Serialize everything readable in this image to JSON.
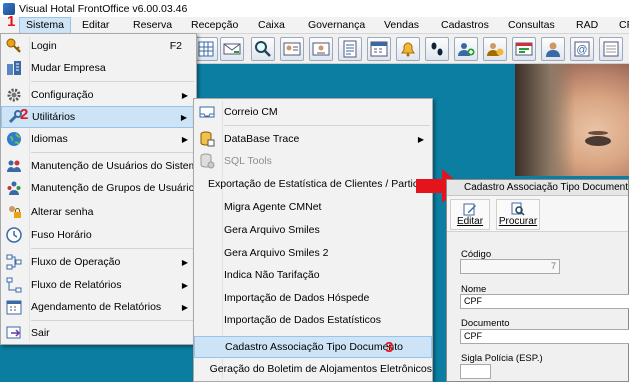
{
  "window": {
    "title": "Visual Hotal FrontOffice v6.00.03.46"
  },
  "menubar": {
    "items": [
      {
        "label": "Sistema"
      },
      {
        "label": "Editar"
      },
      {
        "label": "Reserva"
      },
      {
        "label": "Recepção"
      },
      {
        "label": "Caixa"
      },
      {
        "label": "Governança"
      },
      {
        "label": "Vendas"
      },
      {
        "label": "Cadastros"
      },
      {
        "label": "Consultas"
      },
      {
        "label": "RAD"
      },
      {
        "label": "CF"
      }
    ]
  },
  "steps": {
    "one": "1",
    "two": "2",
    "three": "3"
  },
  "sistema_menu": {
    "items": [
      {
        "label": "Login",
        "shortcut": "F2",
        "icon": "key-icon"
      },
      {
        "label": "Mudar Empresa",
        "icon": "buildings-icon"
      },
      {
        "label": "Configuração",
        "icon": "gear-icon"
      },
      {
        "label": "Utilitários",
        "icon": "wrench-icon"
      },
      {
        "label": "Idiomas",
        "icon": "globe-icon"
      },
      {
        "label": "Manutenção de Usuários do Sistema",
        "icon": "users-icon"
      },
      {
        "label": "Manutenção de Grupos de Usuários",
        "icon": "user-group-icon"
      },
      {
        "label": "Alterar senha",
        "icon": "lock-icon"
      },
      {
        "label": "Fuso Horário",
        "icon": "clock-icon"
      },
      {
        "label": "Fluxo de Operação",
        "icon": "flowchart-icon"
      },
      {
        "label": "Fluxo de Relatórios",
        "icon": "report-flow-icon"
      },
      {
        "label": "Agendamento de Relatórios",
        "icon": "schedule-icon"
      },
      {
        "label": "Sair",
        "icon": "exit-icon"
      }
    ]
  },
  "utilitarios_menu": {
    "items": [
      {
        "label": "Correio CM",
        "icon": "mail-tray-icon"
      },
      {
        "label": "DataBase Trace",
        "icon": "database-icon"
      },
      {
        "label": "SQL Tools",
        "icon": "sql-tools-icon"
      },
      {
        "label": "Exportação de Estatística de Clientes / Particular"
      },
      {
        "label": "Migra Agente CMNet"
      },
      {
        "label": "Gera Arquivo Smiles"
      },
      {
        "label": "Gera Arquivo Smiles 2"
      },
      {
        "label": "Indica Não Tarifação"
      },
      {
        "label": "Importação de Dados Hóspede"
      },
      {
        "label": "Importação de Dados Estatísticos"
      },
      {
        "label": "Cadastro Associação Tipo Documento"
      },
      {
        "label": "Geração do Boletim de Alojamentos Eletrônicos"
      }
    ]
  },
  "form": {
    "title": "Cadastro Associação Tipo Documento",
    "toolbar": {
      "edit_label": "Editar",
      "search_label": "Procurar"
    },
    "fields": {
      "codigo_label": "Código",
      "codigo_value": "7",
      "nome_label": "Nome",
      "nome_value": "CPF",
      "documento_label": "Documento",
      "documento_value": "CPF",
      "sigla_label": "Sigla Polícia (ESP.)",
      "sigla_value": ""
    }
  }
}
